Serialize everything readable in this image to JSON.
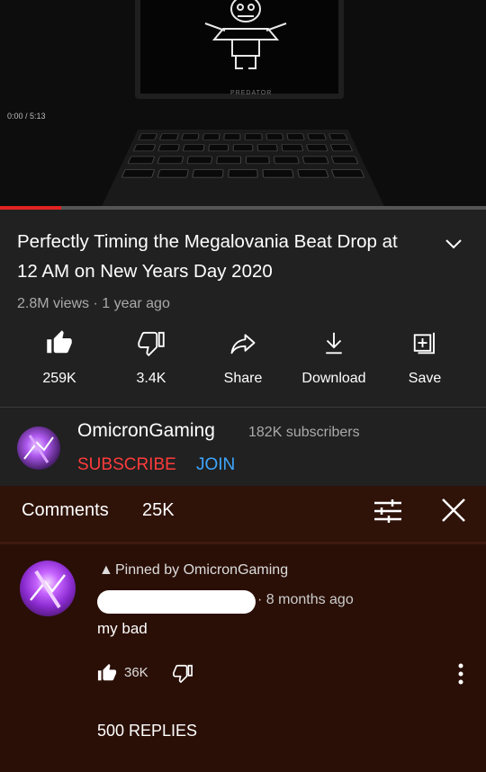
{
  "player": {
    "time": "0:00 / 5:13",
    "brand": "PREDATOR",
    "progress": 0.125,
    "progress_color": "#e22222"
  },
  "video": {
    "title": "Perfectly Timing the Megalovania Beat Drop at 12 AM on New Years Day 2020",
    "meta": "2.8M views · 1 year ago"
  },
  "actions": {
    "like": {
      "label": "259K",
      "icon": "thumb-up-filled-icon"
    },
    "dislike": {
      "label": "3.4K",
      "icon": "thumb-down-icon"
    },
    "share": {
      "label": "Share",
      "icon": "share-arrow-icon"
    },
    "download": {
      "label": "Download",
      "icon": "download-icon"
    },
    "save": {
      "label": "Save",
      "icon": "playlist-add-icon"
    }
  },
  "channel": {
    "name": "OmicronGaming",
    "subscribers": "182K subscribers",
    "subscribe_label": "SUBSCRIBE",
    "join_label": "JOIN"
  },
  "comments": {
    "title": "Comments",
    "count": "25K",
    "pinned": {
      "pinned_label": "Pinned by OmicronGaming",
      "time": "· 8 months ago",
      "text": "my bad",
      "likes": "36K",
      "replies": "500 REPLIES"
    }
  },
  "colors": {
    "background": "#212121",
    "comments_bg": "#2a0f06",
    "subscribe": "#ff3b3b",
    "join": "#3ea6ff"
  }
}
